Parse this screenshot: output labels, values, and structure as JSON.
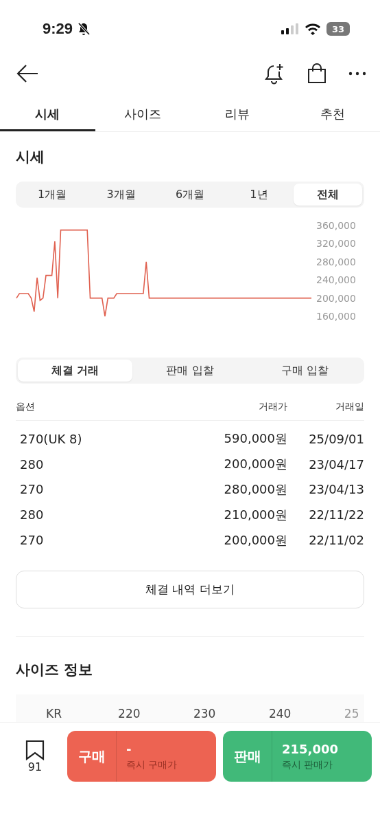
{
  "status_bar": {
    "time": "9:29",
    "battery": "33"
  },
  "tabs": [
    {
      "label": "시세",
      "selected": true
    },
    {
      "label": "사이즈",
      "selected": false
    },
    {
      "label": "리뷰",
      "selected": false
    },
    {
      "label": "추천",
      "selected": false
    }
  ],
  "price_section": {
    "title": "시세",
    "periods": [
      {
        "label": "1개월",
        "selected": false
      },
      {
        "label": "3개월",
        "selected": false
      },
      {
        "label": "6개월",
        "selected": false
      },
      {
        "label": "1년",
        "selected": false
      },
      {
        "label": "전체",
        "selected": true
      }
    ],
    "chart_data": {
      "type": "line",
      "ylim": [
        160000,
        360000
      ],
      "yticks": [
        {
          "value": 360000,
          "label": "360,000"
        },
        {
          "value": 320000,
          "label": "320,000"
        },
        {
          "value": 280000,
          "label": "280,000"
        },
        {
          "value": 240000,
          "label": "240,000"
        },
        {
          "value": 200000,
          "label": "200,000"
        },
        {
          "value": 160000,
          "label": "160,000"
        }
      ],
      "series": [
        {
          "color": "#e0604f",
          "values": [
            200000,
            210000,
            210000,
            210000,
            210000,
            200000,
            170000,
            245000,
            195000,
            200000,
            250000,
            250000,
            250000,
            325000,
            200000,
            350000,
            350000,
            350000,
            350000,
            350000,
            350000,
            350000,
            350000,
            350000,
            350000,
            200000,
            200000,
            200000,
            200000,
            200000,
            160000,
            200000,
            200000,
            200000,
            210000,
            210000,
            210000,
            210000,
            210000,
            210000,
            210000,
            210000,
            210000,
            210000,
            280000,
            200000,
            200000,
            200000,
            200000,
            200000,
            200000,
            200000,
            200000,
            200000,
            200000,
            200000,
            200000,
            200000,
            200000,
            200000,
            200000,
            200000,
            200000,
            200000,
            200000,
            200000,
            200000,
            200000,
            200000,
            200000,
            200000,
            200000,
            200000,
            200000,
            200000,
            200000,
            200000,
            200000,
            200000,
            200000,
            200000,
            200000,
            200000,
            200000,
            200000,
            200000,
            200000,
            200000,
            200000,
            200000,
            200000,
            200000,
            200000,
            200000,
            200000,
            200000,
            200000,
            200000,
            200000,
            200000,
            200000
          ]
        }
      ]
    }
  },
  "trade_tabs": [
    {
      "label": "체결 거래",
      "selected": true
    },
    {
      "label": "판매 입찰",
      "selected": false
    },
    {
      "label": "구매 입찰",
      "selected": false
    }
  ],
  "table": {
    "columns": [
      "옵션",
      "거래가",
      "거래일"
    ],
    "rows": [
      [
        "270(UK 8)",
        "590,000원",
        "25/09/01"
      ],
      [
        "280",
        "200,000원",
        "23/04/17"
      ],
      [
        "270",
        "280,000원",
        "23/04/13"
      ],
      [
        "280",
        "210,000원",
        "22/11/22"
      ],
      [
        "270",
        "200,000원",
        "22/11/02"
      ]
    ]
  },
  "more_button": "체결 내역 더보기",
  "size_section": {
    "title": "사이즈 정보",
    "header": [
      "KR",
      "220",
      "230",
      "240",
      "25"
    ]
  },
  "bottom_bar": {
    "bookmark_count": "91",
    "buy": {
      "label": "구매",
      "price": "-",
      "caption": "즉시 구매가"
    },
    "sell": {
      "label": "판매",
      "price": "215,000",
      "caption": "즉시 판매가"
    }
  }
}
